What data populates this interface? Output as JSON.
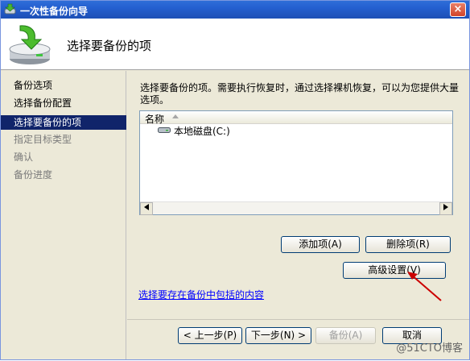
{
  "window": {
    "title": "一次性备份向导",
    "close_glyph": "×"
  },
  "header": {
    "title": "选择要备份的项"
  },
  "nav": {
    "items": [
      {
        "label": "备份选项",
        "state": "normal"
      },
      {
        "label": "选择备份配置",
        "state": "normal"
      },
      {
        "label": "选择要备份的项",
        "state": "active"
      },
      {
        "label": "指定目标类型",
        "state": "disabled"
      },
      {
        "label": "确认",
        "state": "disabled"
      },
      {
        "label": "备份进度",
        "state": "disabled"
      }
    ]
  },
  "main": {
    "description": "选择要备份的项。需要执行恢复时，通过选择裸机恢复，可以为您提供大量选项。",
    "list": {
      "column_header": "名称",
      "items": [
        {
          "label": "本地磁盘(C:)",
          "icon": "disk-icon"
        }
      ]
    },
    "buttons": {
      "add": "添加项(A)",
      "remove": "删除项(R)",
      "advanced": "高级设置(V)"
    },
    "link": "选择要存在备份中包括的内容"
  },
  "footer": {
    "prev": "< 上一步(P)",
    "next": "下一步(N) >",
    "backup": "备份(A)",
    "cancel": "取消"
  },
  "watermark": "@51CTO博客",
  "colors": {
    "accent": "#10246a",
    "annotation_arrow": "#cc0000"
  }
}
